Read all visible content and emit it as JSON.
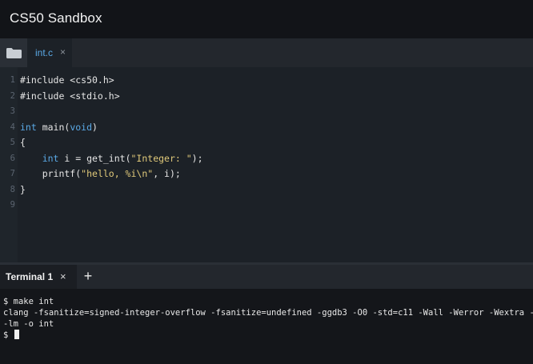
{
  "app": {
    "title": "CS50 Sandbox"
  },
  "editor": {
    "tab": {
      "label": "int.c",
      "close_glyph": "×"
    },
    "lines": [
      {
        "number": "1",
        "tokens": [
          {
            "text": "#include <cs50.h>",
            "kind": "plain"
          }
        ]
      },
      {
        "number": "2",
        "tokens": [
          {
            "text": "#include <stdio.h>",
            "kind": "plain"
          }
        ]
      },
      {
        "number": "3",
        "tokens": []
      },
      {
        "number": "4",
        "tokens": [
          {
            "text": "int",
            "kind": "kw"
          },
          {
            "text": " main(",
            "kind": "plain"
          },
          {
            "text": "void",
            "kind": "kw"
          },
          {
            "text": ")",
            "kind": "plain"
          }
        ]
      },
      {
        "number": "5",
        "tokens": [
          {
            "text": "{",
            "kind": "plain"
          }
        ]
      },
      {
        "number": "6",
        "tokens": [
          {
            "text": "    ",
            "kind": "plain"
          },
          {
            "text": "int",
            "kind": "kw"
          },
          {
            "text": " i = get_int(",
            "kind": "plain"
          },
          {
            "text": "\"Integer: \"",
            "kind": "str"
          },
          {
            "text": ");",
            "kind": "plain"
          }
        ]
      },
      {
        "number": "7",
        "tokens": [
          {
            "text": "    printf(",
            "kind": "plain"
          },
          {
            "text": "\"hello, %i\\n\"",
            "kind": "str"
          },
          {
            "text": ", i);",
            "kind": "plain"
          }
        ]
      },
      {
        "number": "8",
        "tokens": [
          {
            "text": "}",
            "kind": "plain"
          }
        ]
      },
      {
        "number": "9",
        "tokens": []
      }
    ]
  },
  "terminal": {
    "tab_label": "Terminal 1",
    "close_glyph": "×",
    "new_tab_glyph": "+",
    "lines": [
      "$ make int",
      "clang -fsanitize=signed-integer-overflow -fsanitize=undefined -ggdb3 -O0 -std=c11 -Wall -Werror -Wextra -Wno",
      "-lm -o int",
      "$ "
    ]
  },
  "icons": {
    "folder": "folder-icon"
  },
  "colors": {
    "keyword": "#5aa9e6",
    "string": "#e0c97a",
    "active_tab_text": "#5aa9e6"
  }
}
